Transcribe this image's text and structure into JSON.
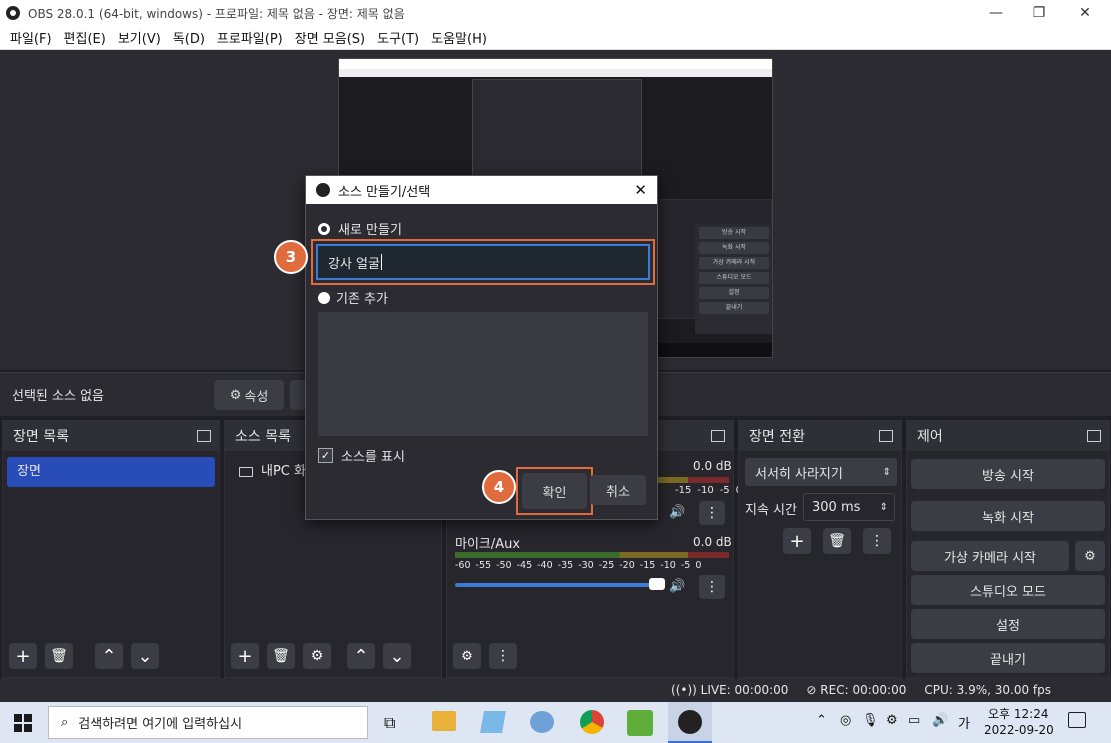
{
  "window": {
    "title": "OBS 28.0.1 (64-bit, windows) - 프로파일: 제목 없음 - 장면: 제목 없음",
    "minimize": "—",
    "maximize": "❐",
    "close": "✕"
  },
  "menu": [
    "파일(F)",
    "편집(E)",
    "보기(V)",
    "독(D)",
    "프로파일(P)",
    "장면 모음(S)",
    "도구(T)",
    "도움말(H)"
  ],
  "selection_bar": {
    "no_source": "선택된 소스 없음",
    "properties": "속성"
  },
  "scenes_dock": {
    "title": "장면 목록",
    "items": [
      "장면"
    ]
  },
  "sources_dock": {
    "title": "소스 목록",
    "items": [
      "내PC 화"
    ]
  },
  "mixer": {
    "channels": [
      {
        "name": "",
        "level": "0.0 dB"
      },
      {
        "name": "마이크/Aux",
        "level": "0.0 dB"
      }
    ],
    "scale": [
      "-60",
      "-55",
      "-50",
      "-45",
      "-40",
      "-35",
      "-30",
      "-25",
      "-20",
      "-15",
      "-10",
      "-5",
      "0"
    ],
    "scale_partial": [
      "-15",
      "-10",
      "-5",
      "0"
    ]
  },
  "transitions_dock": {
    "title": "장면 전환",
    "transition": "서서히 사라지기",
    "duration_label": "지속 시간",
    "duration": "300 ms"
  },
  "controls_dock": {
    "title": "제어",
    "start_stream": "방송 시작",
    "start_record": "녹화 시작",
    "virtual_cam": "가상 카메라 시작",
    "studio_mode": "스튜디오 모드",
    "settings": "설정",
    "exit": "끝내기"
  },
  "status": {
    "live": "LIVE: 00:00:00",
    "rec": "REC: 00:00:00",
    "cpu": "CPU: 3.9%, 30.00 fps"
  },
  "dialog": {
    "title": "소스 만들기/선택",
    "create_new": "새로 만들기",
    "name_value": "강사 얼굴",
    "add_existing": "기존 추가",
    "show_source": "소스를 표시",
    "ok": "확인",
    "cancel": "취소"
  },
  "markers": {
    "step3": "3",
    "step4": "4"
  },
  "preview_controls": [
    "방송 시작",
    "녹화 시작",
    "가상 카메라 시작",
    "스튜디오 모드",
    "설정",
    "끝내기"
  ],
  "taskbar": {
    "search_placeholder": "검색하려면 여기에 입력하십시",
    "time": "오후 12:24",
    "date": "2022-09-20",
    "ime": "가"
  },
  "colors": {
    "accent": "#284cb8",
    "highlight": "#e06b3c",
    "dock_bg": "#26262c",
    "panel_bg": "#2b2b31"
  }
}
